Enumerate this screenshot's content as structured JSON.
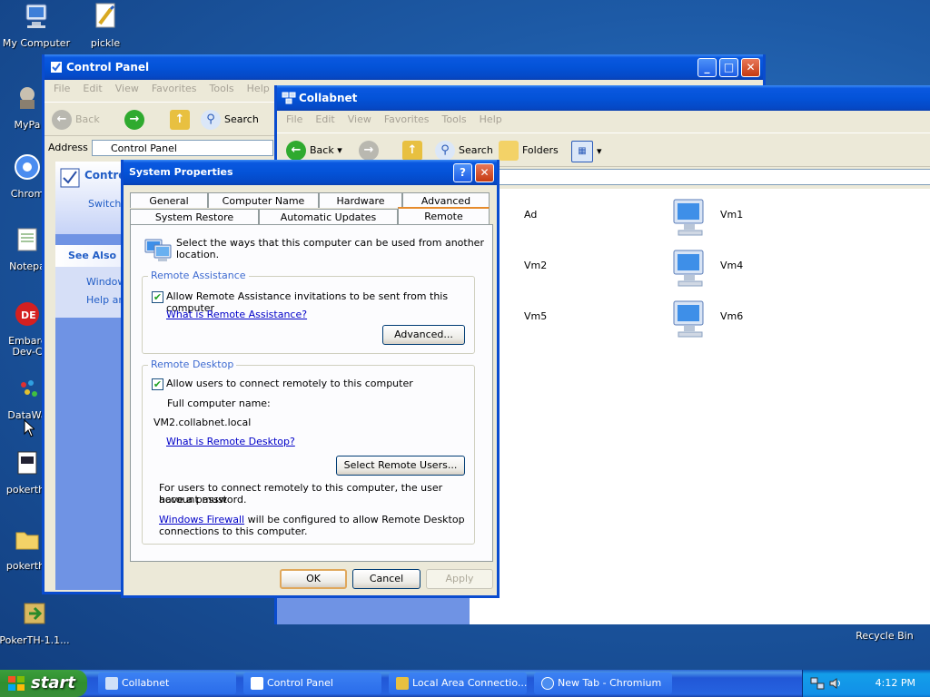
{
  "desktop": {
    "icons": [
      {
        "label": "My Computer",
        "icon": "my-computer-icon"
      },
      {
        "label": "pickle",
        "icon": "shortcut-icon"
      },
      {
        "label": "MyPa",
        "icon": "program-icon"
      },
      {
        "label": "Chrom",
        "icon": "chromium-icon"
      },
      {
        "label": "Notepa",
        "icon": "notepad-icon"
      },
      {
        "label": "Embarc",
        "label2": "Dev-C",
        "icon": "embarcadero-icon"
      },
      {
        "label": "DataWa",
        "icon": "datawarrior-icon"
      },
      {
        "label": "pokerth-",
        "icon": "pokerth-icon"
      },
      {
        "label": "pokerth-",
        "icon": "folder-icon"
      },
      {
        "label": "PokerTH-1.1...",
        "icon": "installer-icon"
      },
      {
        "label": "Recycle Bin",
        "icon": "recycle-bin-icon"
      }
    ]
  },
  "control_panel": {
    "title": "Control Panel",
    "menu": [
      "File",
      "Edit",
      "View",
      "Favorites",
      "Tools",
      "Help"
    ],
    "toolbar": {
      "back": "Back",
      "search": "Search"
    },
    "address_label": "Address",
    "address_value": "Control Panel",
    "side_header": "Contro",
    "side_link": "Switch",
    "see_also": "See Also",
    "see_also_items": [
      "Window",
      "Help an"
    ]
  },
  "collabnet": {
    "title": "Collabnet",
    "menu": [
      "File",
      "Edit",
      "View",
      "Favorites",
      "Tools",
      "Help"
    ],
    "toolbar": {
      "back": "Back",
      "search": "Search",
      "folders": "Folders"
    },
    "items": [
      {
        "label": "Ad"
      },
      {
        "label": "Vm1"
      },
      {
        "label": "Vm2"
      },
      {
        "label": "Vm4"
      },
      {
        "label": "Vm5"
      },
      {
        "label": "Vm6"
      }
    ]
  },
  "dialog": {
    "title": "System Properties",
    "tabs_row1": [
      "General",
      "Computer Name",
      "Hardware",
      "Advanced"
    ],
    "tabs_row2": [
      "System Restore",
      "Automatic Updates",
      "Remote"
    ],
    "intro_line1": "Select the ways that this computer can be used from another",
    "intro_line2": "location.",
    "remote_assistance": {
      "title": "Remote Assistance",
      "checkbox_label": "Allow Remote Assistance invitations to be sent from this computer",
      "checked": true,
      "link": "What is Remote Assistance?",
      "advanced_button": "Advanced..."
    },
    "remote_desktop": {
      "title": "Remote Desktop",
      "checkbox_label": "Allow users to connect remotely to this computer",
      "checked": true,
      "full_name_label": "Full computer name:",
      "full_name_value": "VM2.collabnet.local",
      "link": "What is Remote Desktop?",
      "select_button": "Select Remote Users...",
      "note_line1": "For users to connect remotely to this computer, the user account must",
      "note_line2": "have a password.",
      "firewall_link": "Windows Firewall",
      "firewall_text1": " will be configured to allow Remote Desktop",
      "firewall_text2": "connections to this computer."
    },
    "buttons": {
      "ok": "OK",
      "cancel": "Cancel",
      "apply": "Apply"
    }
  },
  "taskbar": {
    "start": "start",
    "tasks": [
      {
        "label": "Collabnet",
        "icon": "network-folder-icon"
      },
      {
        "label": "Control Panel",
        "icon": "control-panel-icon"
      },
      {
        "label": "Local Area Connectio...",
        "icon": "network-connection-icon"
      },
      {
        "label": "New Tab - Chromium",
        "icon": "chromium-icon"
      }
    ],
    "clock": "4:12 PM"
  },
  "colors": {
    "titlebar": "#0453d8",
    "taskbar": "#2663e0",
    "start": "#3c9e3c",
    "desktop": "#1d5aa6"
  }
}
